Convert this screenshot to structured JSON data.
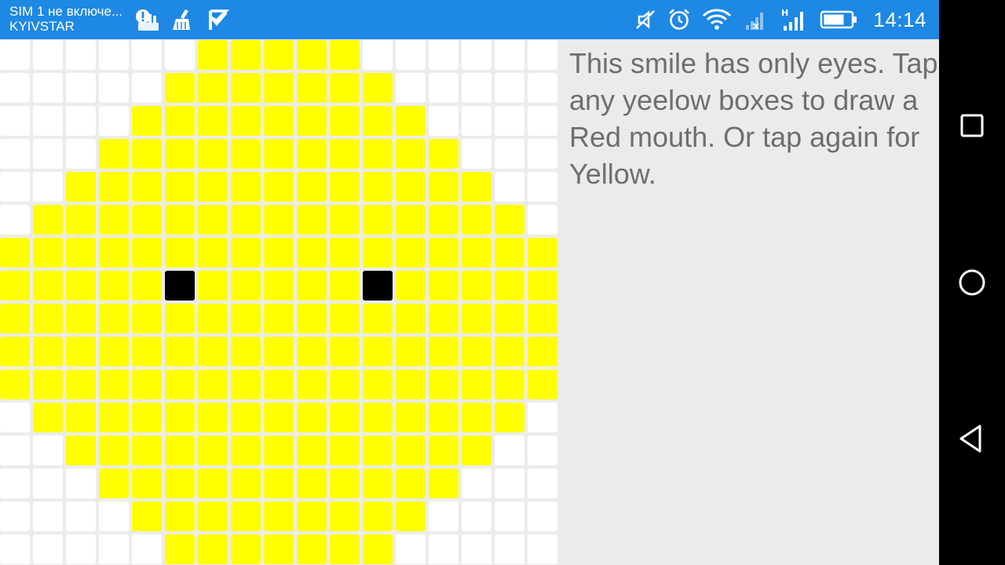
{
  "status_bar": {
    "sim_status": "SIM 1 не включе...",
    "carrier": "KYIVSTAR",
    "time": "14:14",
    "network_type": "H",
    "background_color": "#1e88e5",
    "left_icons": [
      "alert-storage-icon",
      "broom-icon",
      "check-flag-icon"
    ],
    "right_icons": [
      "mute-icon",
      "alarm-icon",
      "wifi-icon",
      "signal-sim1-icon",
      "signal-sim2-icon",
      "battery-icon"
    ]
  },
  "instructions": {
    "text": "This smile has only eyes. Tap any yeelow boxes to draw a Red mouth. Or tap again for Yellow."
  },
  "grid": {
    "columns": 17,
    "rows": 16,
    "colors": {
      "yellow": "#ffff00",
      "white": "#ffffff",
      "black": "#000000",
      "red": "#ff0000"
    },
    "yellow_spans": [
      [
        6,
        10
      ],
      [
        5,
        11
      ],
      [
        4,
        12
      ],
      [
        3,
        13
      ],
      [
        2,
        14
      ],
      [
        1,
        15
      ],
      [
        0,
        16
      ],
      [
        0,
        16
      ],
      [
        0,
        16
      ],
      [
        0,
        16
      ],
      [
        0,
        16
      ],
      [
        1,
        15
      ],
      [
        2,
        14
      ],
      [
        3,
        13
      ],
      [
        4,
        12
      ],
      [
        5,
        11
      ]
    ],
    "eyes": [
      [
        7,
        5
      ],
      [
        7,
        11
      ]
    ]
  },
  "nav_bar": {
    "buttons": [
      "recent-apps",
      "home",
      "back"
    ]
  }
}
